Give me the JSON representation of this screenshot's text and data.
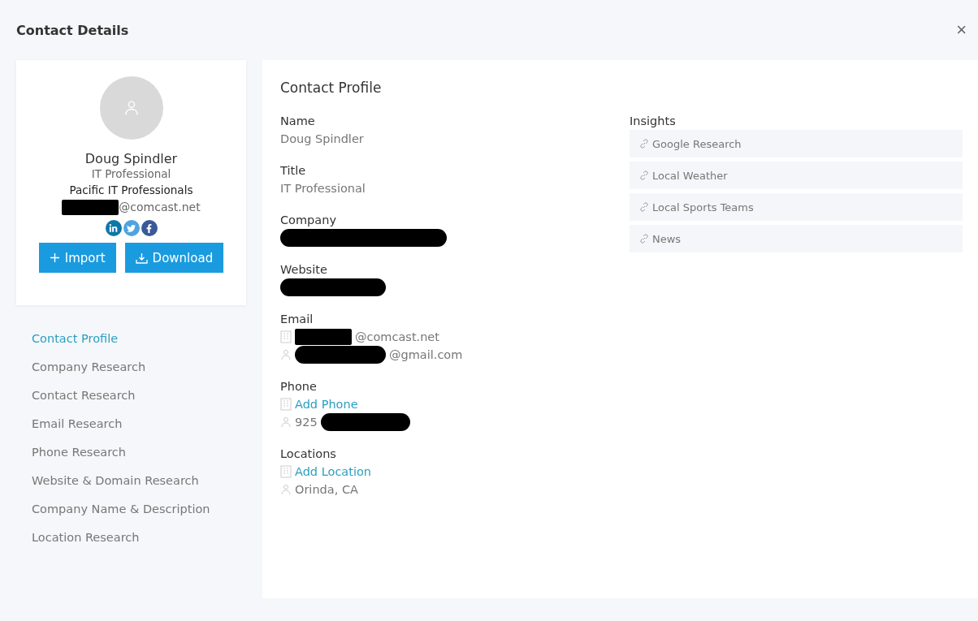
{
  "window": {
    "title": "Contact Details",
    "close": "×"
  },
  "profile_card": {
    "name": "Doug Spindler",
    "title": "IT Professional",
    "company": "Pacific IT Professionals",
    "email": {
      "redacted": true,
      "text": "@comcast.net"
    },
    "buttons": [
      {
        "kind": "import",
        "label": "Import"
      },
      {
        "kind": "download",
        "label": "Download"
      }
    ]
  },
  "nav": [
    {
      "label": "Contact Profile",
      "selected": true
    },
    {
      "label": "Company Research",
      "selected": false
    },
    {
      "label": "Contact Research",
      "selected": false
    },
    {
      "label": "Email Research",
      "selected": false
    },
    {
      "label": "Phone Research",
      "selected": false
    },
    {
      "label": "Website & Domain Research",
      "selected": false
    },
    {
      "label": "Company Name & Description",
      "selected": false
    },
    {
      "label": "Location Research",
      "selected": false
    }
  ],
  "contact_profile": {
    "heading": "Contact Profile",
    "fields": [
      {
        "label": "Name",
        "values": [
          {
            "text": "Doug Spindler"
          }
        ]
      },
      {
        "label": "Title",
        "values": [
          {
            "text": "IT Professional"
          }
        ]
      },
      {
        "label": "Company",
        "values": [
          {
            "redacted": true
          }
        ]
      },
      {
        "label": "Website",
        "values": [
          {
            "redacted": true
          }
        ]
      },
      {
        "label": "Email",
        "values": [
          {
            "kind": "work",
            "redacted": true,
            "text": "@comcast.net"
          },
          {
            "kind": "personal",
            "redacted": true,
            "text": "@gmail.com"
          }
        ]
      },
      {
        "label": "Phone",
        "values": [
          {
            "kind": "work",
            "link": true,
            "text": "Add Phone"
          },
          {
            "kind": "personal",
            "redacted": true,
            "text": "925"
          }
        ]
      },
      {
        "label": "Locations",
        "values": [
          {
            "kind": "work",
            "link": true,
            "text": "Add Location"
          },
          {
            "kind": "personal",
            "text": "Orinda, CA"
          }
        ]
      }
    ],
    "insights": {
      "heading": "Insights",
      "items": [
        "Google Research",
        "Local Weather",
        "Local Sports Teams",
        "News"
      ]
    }
  }
}
